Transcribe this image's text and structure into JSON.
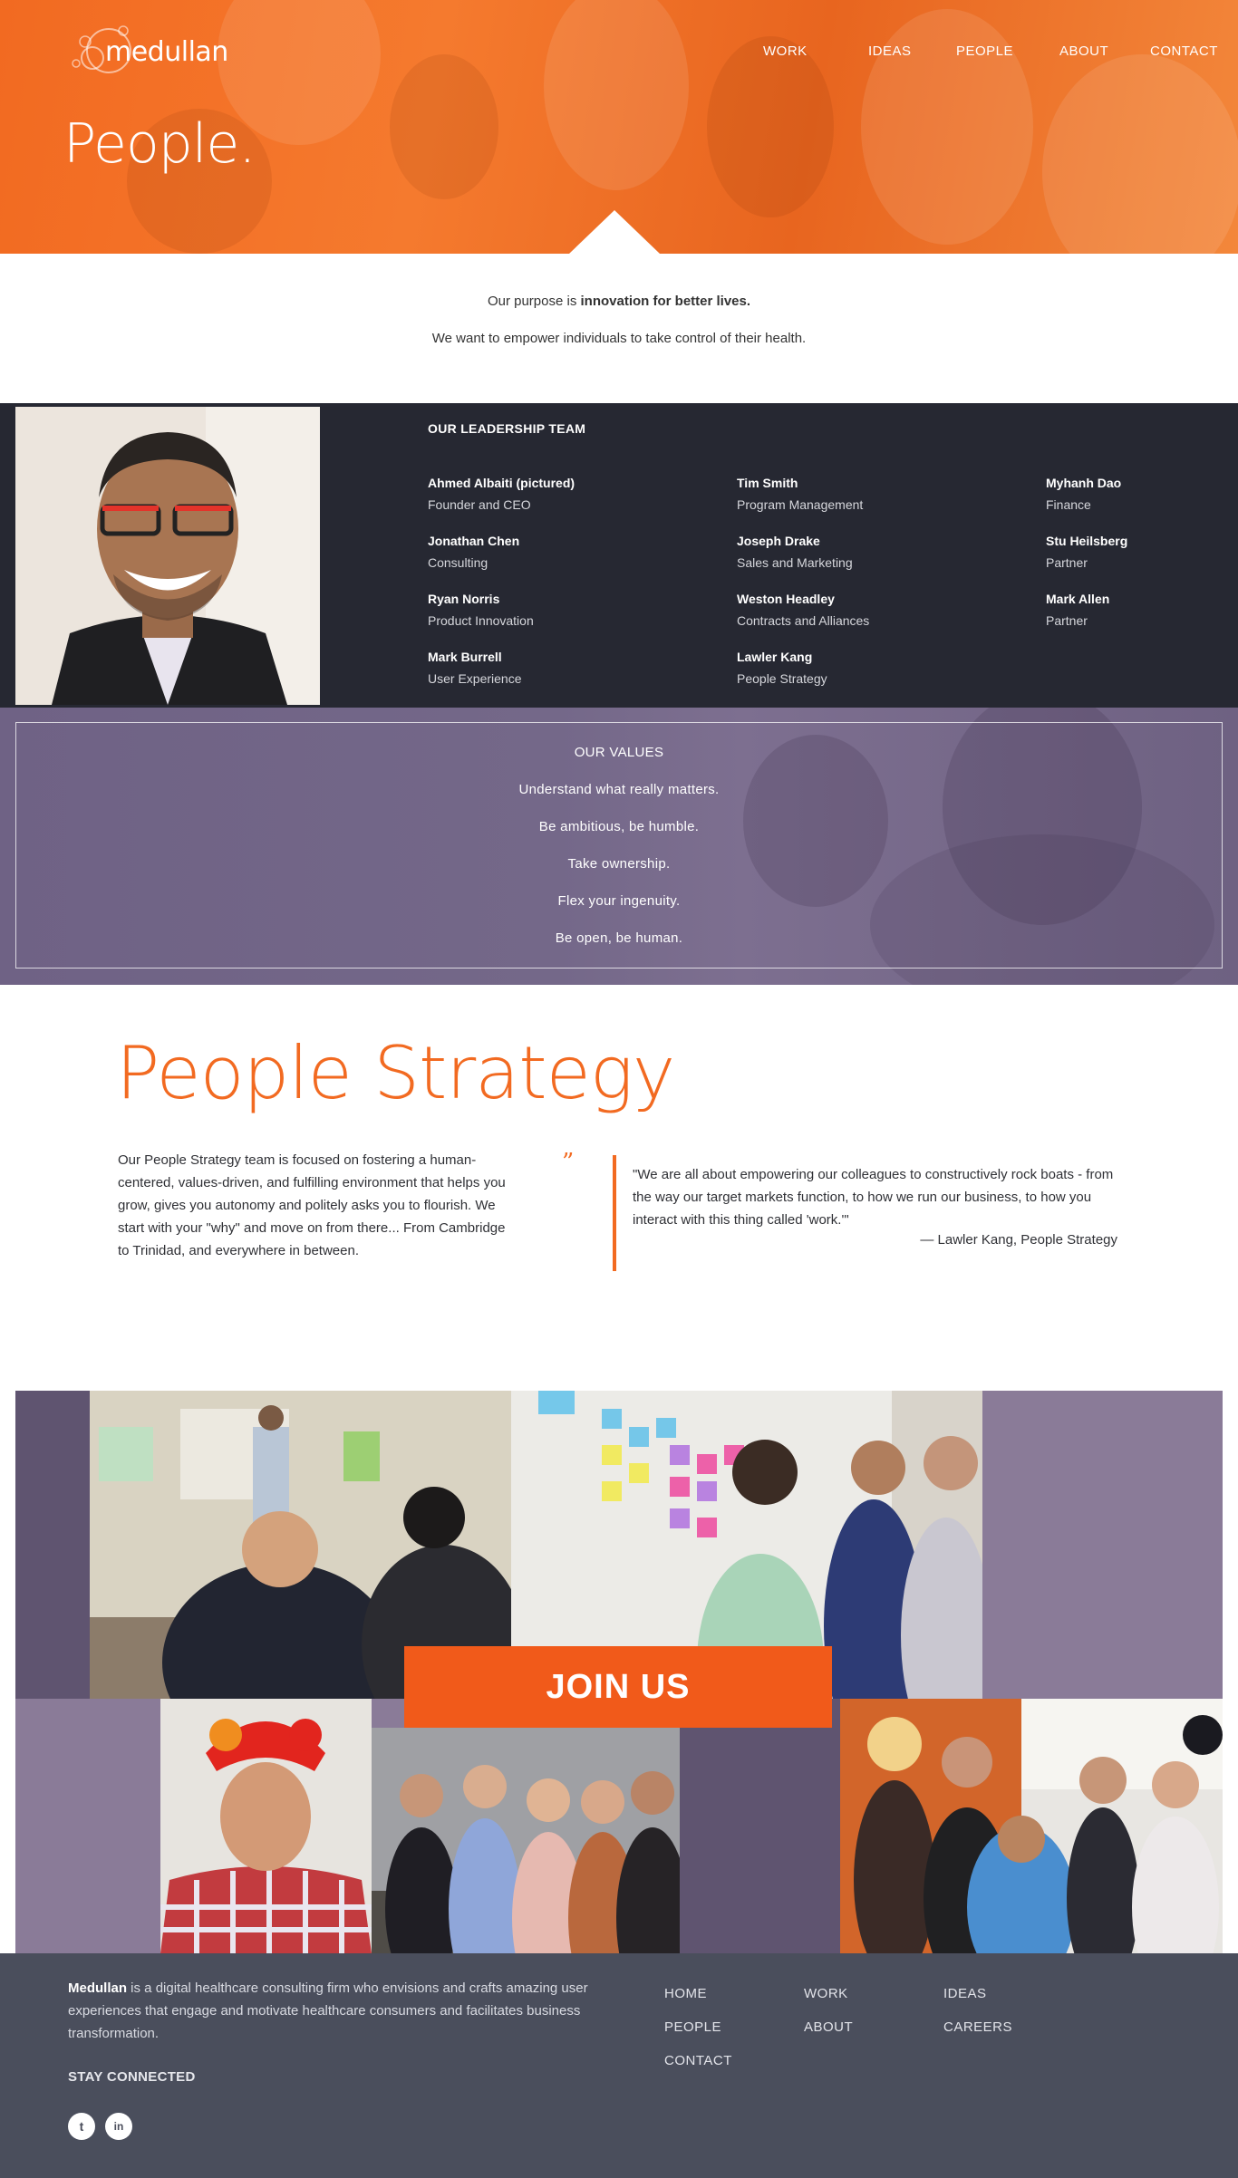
{
  "brand": {
    "name": "medullan"
  },
  "nav": {
    "items": [
      "WORK",
      "IDEAS",
      "PEOPLE",
      "ABOUT",
      "CONTACT"
    ]
  },
  "hero": {
    "title": "People."
  },
  "purpose": {
    "line1_prefix": "Our purpose is ",
    "line1_bold": "innovation for better lives.",
    "line2": "We want to empower individuals to take control of their health."
  },
  "leadership": {
    "title": "OUR LEADERSHIP TEAM",
    "members": [
      {
        "name": "Ahmed Albaiti (pictured)",
        "role": "Founder and CEO"
      },
      {
        "name": "Jonathan Chen",
        "role": "Consulting"
      },
      {
        "name": "Ryan Norris",
        "role": "Product Innovation"
      },
      {
        "name": "Mark Burrell",
        "role": "User Experience"
      },
      {
        "name": "Tim Smith",
        "role": "Program Management"
      },
      {
        "name": "Joseph Drake",
        "role": "Sales and Marketing"
      },
      {
        "name": "Weston Headley",
        "role": "Contracts and Alliances"
      },
      {
        "name": "Lawler Kang",
        "role": "People Strategy"
      },
      {
        "name": "Myhanh Dao",
        "role": "Finance"
      },
      {
        "name": "Stu Heilsberg",
        "role": "Partner"
      },
      {
        "name": "Mark Allen",
        "role": "Partner"
      }
    ]
  },
  "values": {
    "title": "OUR VALUES",
    "items": [
      "Understand what really matters.",
      "Be ambitious, be humble.",
      "Take ownership.",
      "Flex your ingenuity.",
      "Be open, be human."
    ]
  },
  "people_strategy": {
    "title": "People Strategy",
    "body": "Our People Strategy team is focused on fostering a human-centered, values-driven, and fulfilling environment that helps you grow, gives you autonomy and politely asks you to flourish. We start with your \"why\" and move on from there... From Cambridge to Trinidad, and everywhere in between.",
    "quote_mark": "”",
    "quote": "\"We are all about empowering our colleagues to constructively rock boats - from the way our target markets function, to how we run our business, to how you interact with this thing called 'work.'\"",
    "quote_by": "— Lawler Kang, People Strategy"
  },
  "collage": {
    "cta": "JOIN US"
  },
  "footer": {
    "brand": "Medullan",
    "about": " is a digital healthcare consulting firm who envisions and crafts amazing user experiences that engage and motivate healthcare consumers and facilitates business transformation.",
    "stay": "STAY CONNECTED",
    "social": {
      "twitter": "t",
      "linkedin": "in"
    },
    "links": [
      "HOME",
      "WORK",
      "IDEAS",
      "PEOPLE",
      "ABOUT",
      "CAREERS",
      "CONTACT"
    ]
  },
  "colors": {
    "accent": "#f26a21",
    "cta": "#f15a1a",
    "dark_band": "#262832",
    "values_band": "#746889",
    "footer": "#4a4e5c"
  }
}
